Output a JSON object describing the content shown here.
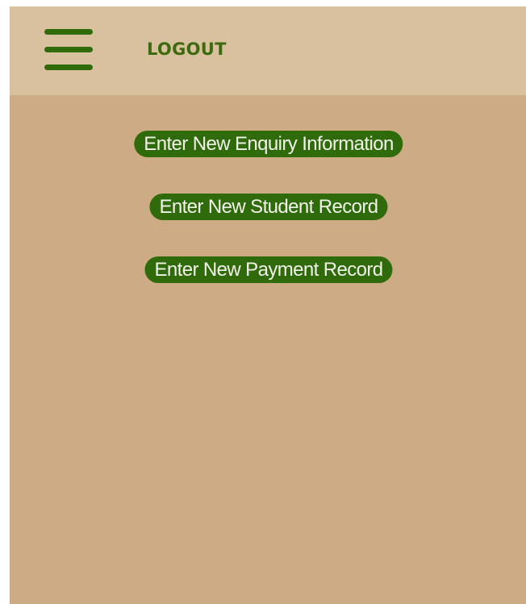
{
  "header": {
    "menu_icon": "hamburger-menu-icon",
    "logout_label": "LOGOUT"
  },
  "actions": [
    {
      "label": "Enter New Enquiry Information"
    },
    {
      "label": "Enter New Student Record"
    },
    {
      "label": "Enter New Payment Record"
    }
  ],
  "colors": {
    "page_background": "#cdab84",
    "header_background": "#d9c19f",
    "accent_green": "#2f6a0b",
    "button_text": "#f2f2ea"
  }
}
